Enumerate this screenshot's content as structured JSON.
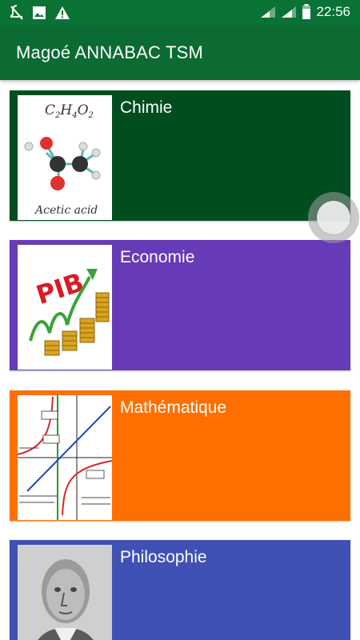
{
  "statusbar": {
    "time": "22:56",
    "icons": [
      "notifications-off-icon",
      "image-icon",
      "warning-icon",
      "signal-icon",
      "signal-icon",
      "battery-icon"
    ]
  },
  "appbar": {
    "title": "Magoé ANNABAC TSM"
  },
  "subjects": [
    {
      "label": "Chimie",
      "color": "#004d20",
      "image_caption": "Acetic acid",
      "image_formula": "C2H4O2"
    },
    {
      "label": "Economie",
      "color": "#673ab7",
      "image_caption": "PIB"
    },
    {
      "label": "Mathématique",
      "color": "#ff6f00"
    },
    {
      "label": "Philosophie",
      "color": "#3f51b5"
    }
  ]
}
